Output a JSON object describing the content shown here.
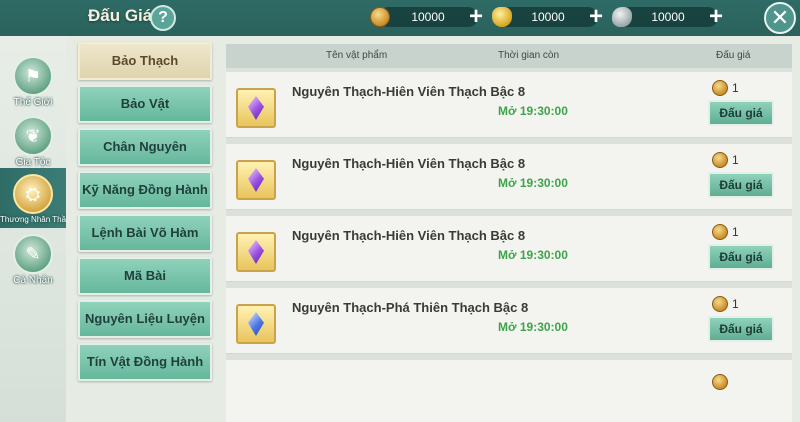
{
  "window": {
    "title": "Đấu Giá",
    "help_label": "?",
    "close_label": "✕"
  },
  "currencies": [
    {
      "icon": "copper-coin-icon",
      "value": "10000"
    },
    {
      "icon": "gold-ingot-icon",
      "value": "10000"
    },
    {
      "icon": "silver-ingot-icon",
      "value": "10000"
    }
  ],
  "sidenav": {
    "items": [
      {
        "label": "Thế Giới"
      },
      {
        "label": "Gia Tộc"
      },
      {
        "label": "Thương Nhân Thần Bí"
      },
      {
        "label": "Cá Nhân"
      }
    ]
  },
  "categories": [
    {
      "label": "Bảo Thạch"
    },
    {
      "label": "Bảo Vật"
    },
    {
      "label": "Chân Nguyên"
    },
    {
      "label": "Kỹ Năng Đồng Hành"
    },
    {
      "label": "Lệnh Bài Võ Hàm"
    },
    {
      "label": "Mã Bài"
    },
    {
      "label": "Nguyên Liệu Luyện Hóa"
    },
    {
      "label": "Tín Vật Đồng Hành"
    }
  ],
  "list": {
    "headers": {
      "name": "Tên vật phẩm",
      "time": "Thời gian còn",
      "bid": "Đấu giá"
    },
    "rows": [
      {
        "name": "Nguyên Thạch-Hiên Viên Thạch Bậc 8",
        "time": "Mở 19:30:00",
        "price": "1",
        "bid_label": "Đấu giá",
        "gem": "purple"
      },
      {
        "name": "Nguyên Thạch-Hiên Viên Thạch Bậc 8",
        "time": "Mở 19:30:00",
        "price": "1",
        "bid_label": "Đấu giá",
        "gem": "purple"
      },
      {
        "name": "Nguyên Thạch-Hiên Viên Thạch Bậc 8",
        "time": "Mở 19:30:00",
        "price": "1",
        "bid_label": "Đấu giá",
        "gem": "purple"
      },
      {
        "name": "Nguyên Thạch-Phá Thiên Thạch Bậc 8",
        "time": "Mở 19:30:00",
        "price": "1",
        "bid_label": "Đấu giá",
        "gem": "blue"
      }
    ]
  },
  "colors": {
    "accent_green": "#66b79c",
    "time_green": "#3da44a",
    "header_teal": "#2f6b66"
  }
}
